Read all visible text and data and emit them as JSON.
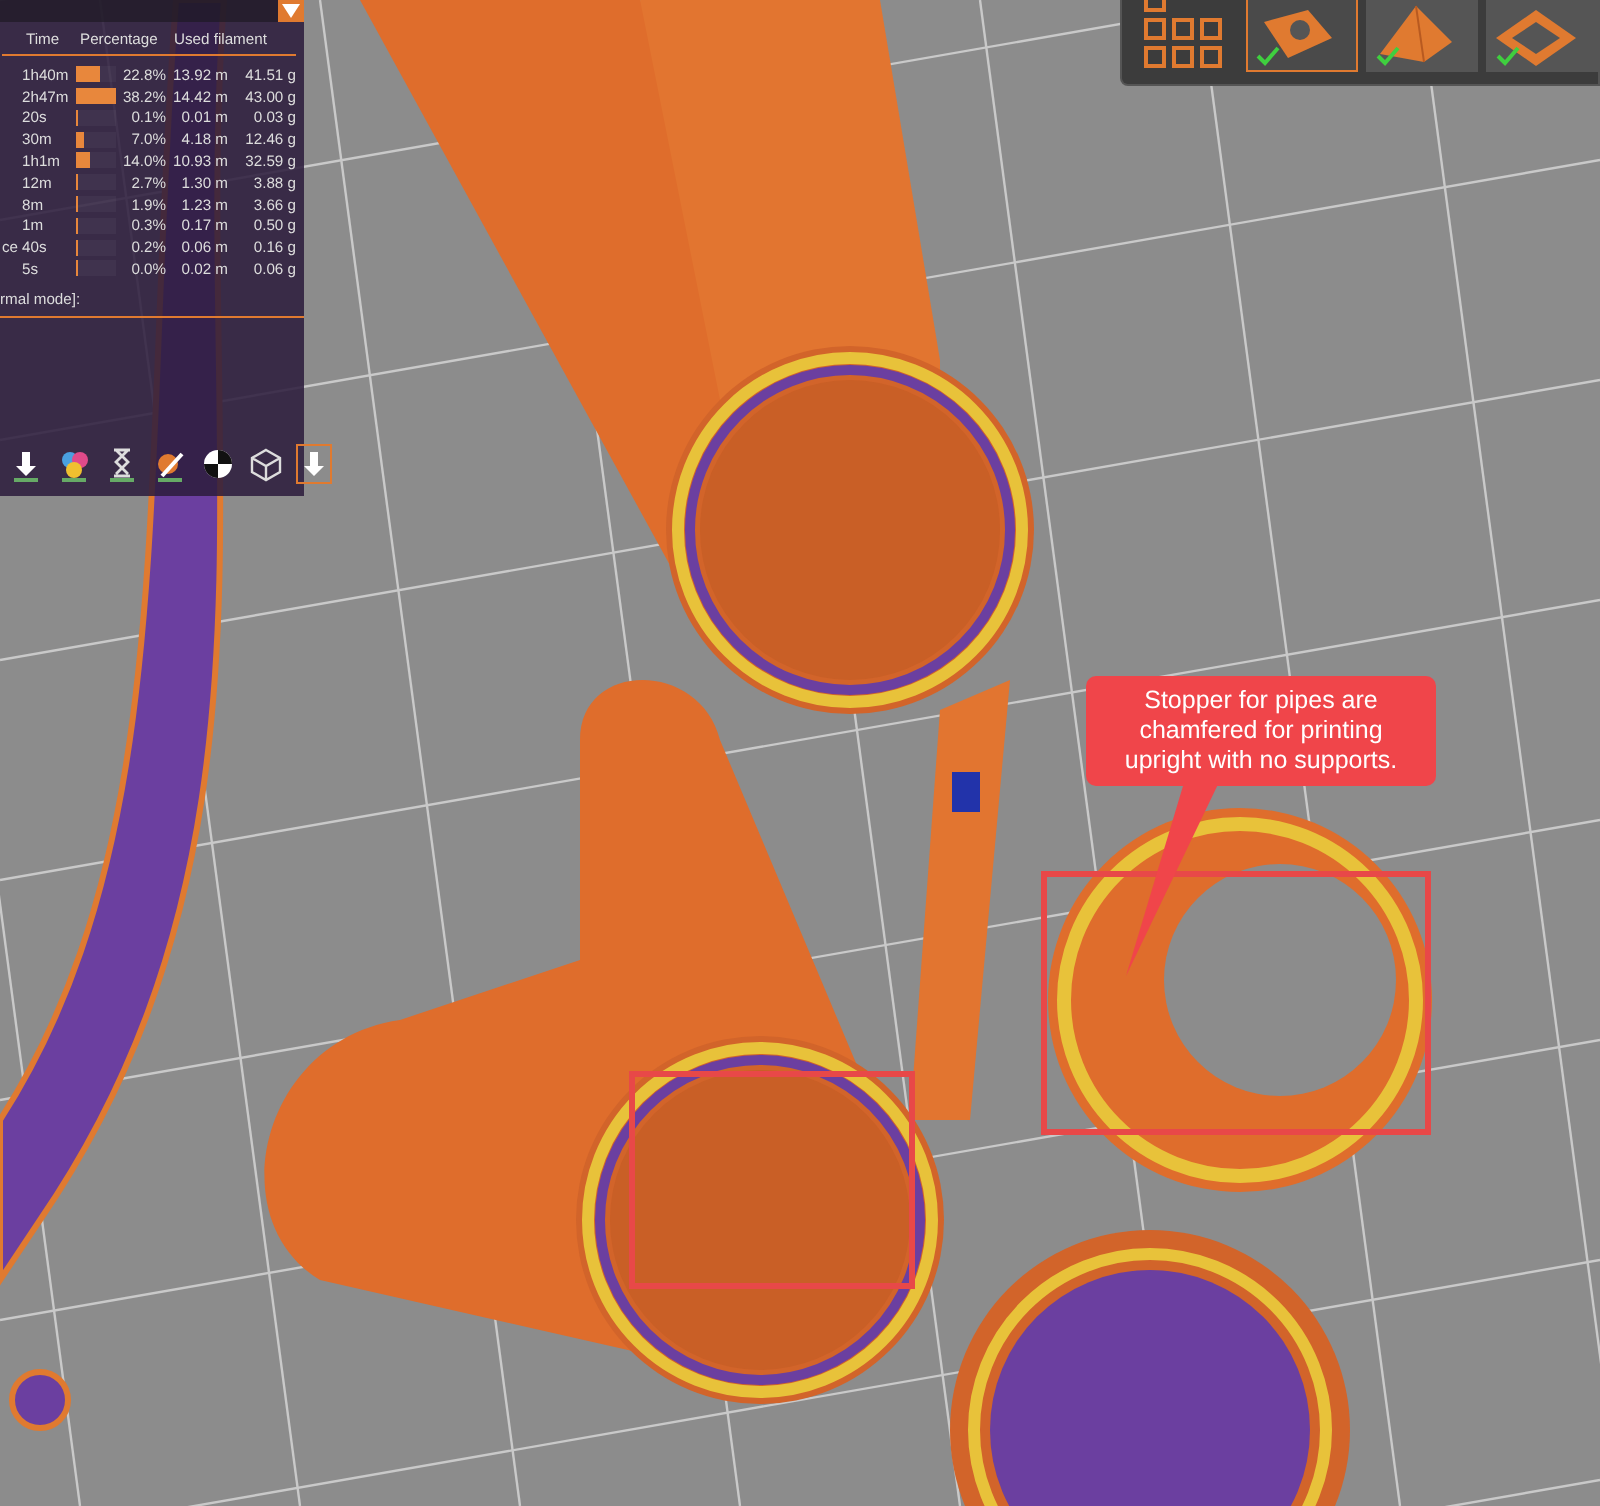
{
  "legend": {
    "columns": [
      "Time",
      "Percentage",
      "Used filament"
    ],
    "rows": [
      {
        "time": "1h40m",
        "level": 0.6,
        "percentage": "22.8%",
        "length": "13.92 m",
        "weight": "41.51 g"
      },
      {
        "time": "2h47m",
        "level": 1.0,
        "percentage": "38.2%",
        "length": "14.42 m",
        "weight": "43.00 g"
      },
      {
        "time": "20s",
        "level": 0.02,
        "percentage": "0.1%",
        "length": "0.01 m",
        "weight": "0.03 g"
      },
      {
        "time": "30m",
        "level": 0.18,
        "percentage": "7.0%",
        "length": "4.18 m",
        "weight": "12.46 g"
      },
      {
        "time": "1h1m",
        "level": 0.37,
        "percentage": "14.0%",
        "length": "10.93 m",
        "weight": "32.59 g"
      },
      {
        "time": "12m",
        "level": 0.07,
        "percentage": "2.7%",
        "length": "1.30 m",
        "weight": "3.88 g"
      },
      {
        "time": "8m",
        "level": 0.05,
        "percentage": "1.9%",
        "length": "1.23 m",
        "weight": "3.66 g"
      },
      {
        "time": "1m",
        "level": 0.01,
        "percentage": "0.3%",
        "length": "0.17 m",
        "weight": "0.50 g"
      },
      {
        "feature": "ce",
        "time": "40s",
        "level": 0.01,
        "percentage": "0.2%",
        "length": "0.06 m",
        "weight": "0.16 g"
      },
      {
        "time": "5s",
        "level": 0.01,
        "percentage": "0.0%",
        "length": "0.02 m",
        "weight": "0.06 g"
      }
    ],
    "footer": "rmal mode]:"
  },
  "view_toolbar": [
    {
      "kind": "tool",
      "selected": false
    },
    {
      "kind": "colors",
      "selected": false
    },
    {
      "kind": "hourglass",
      "selected": false
    },
    {
      "kind": "pencil",
      "selected": false
    },
    {
      "kind": "halfcircle",
      "selected": false
    },
    {
      "kind": "cube",
      "selected": false
    },
    {
      "kind": "arrow",
      "selected": true
    }
  ],
  "object_thumbnails": [
    {
      "kind": "plate",
      "selected": true,
      "checked": true
    },
    {
      "kind": "pyramid",
      "selected": false,
      "checked": true
    },
    {
      "kind": "frame",
      "selected": false,
      "checked": true
    }
  ],
  "callout": {
    "text": "Stopper for pipes are chamfered for printing upright with no supports."
  }
}
